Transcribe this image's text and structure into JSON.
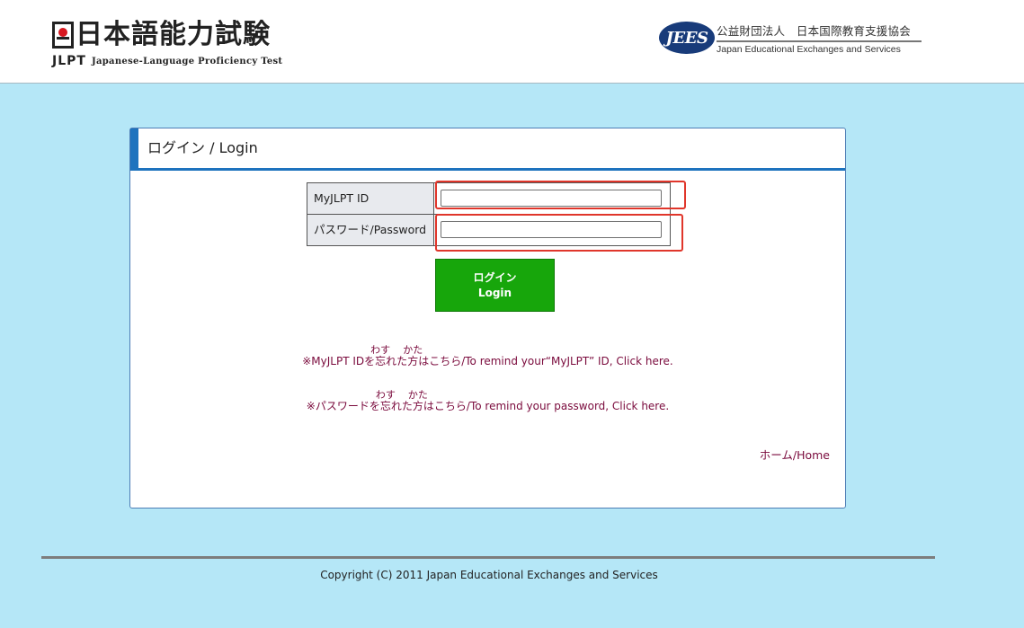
{
  "header": {
    "logo_title": "日本語能力試験",
    "logo_jlpt": "JLPT",
    "logo_subtitle": "Japanese-Language Proficiency Test",
    "jees_logo": "JEES",
    "jees_name_jp": "公益財団法人　日本国際教育支援協会",
    "jees_name_en": "Japan Educational Exchanges and Services"
  },
  "panel": {
    "title": "ログイン / Login"
  },
  "form": {
    "id_label": "MyJLPT ID",
    "id_value": "",
    "password_label": "パスワード/Password",
    "password_value": ""
  },
  "login_button": {
    "label_jp": "ログイン",
    "label_en": "Login"
  },
  "links": {
    "remind_id": {
      "prefix": "※MyJLPT IDを",
      "ruby1_base": "忘",
      "ruby1_reading": "わす",
      "mid": "れた",
      "ruby2_base": "方",
      "ruby2_reading": "かた",
      "suffix": "はこちら/To remind your“MyJLPT” ID, Click here."
    },
    "remind_password": {
      "prefix": "※パスワードを",
      "ruby1_base": "忘",
      "ruby1_reading": "わす",
      "mid": "れた",
      "ruby2_base": "方",
      "ruby2_reading": "かた",
      "suffix": "はこちら/To remind your password, Click here."
    },
    "home": "ホーム/Home"
  },
  "footer": {
    "copyright": "Copyright (C) 2011  Japan Educational Exchanges and Services"
  },
  "colors": {
    "page_background": "#b5e7f7",
    "accent_blue": "#1e73be",
    "login_button": "#17a60b",
    "link": "#7a0a3c",
    "highlight": "#e0362b"
  }
}
